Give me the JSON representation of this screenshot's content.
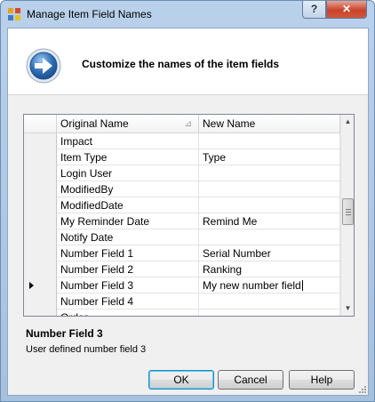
{
  "window": {
    "title": "Manage Item Field Names",
    "help_glyph": "?",
    "close_glyph": "✕"
  },
  "header": {
    "icon": "right-arrow-circle-icon",
    "text": "Customize the names of the item fields"
  },
  "grid": {
    "columns": [
      "Original Name",
      "New Name"
    ],
    "sort_column": "Original Name",
    "rows": [
      {
        "original": "Impact",
        "new": ""
      },
      {
        "original": "Item Type",
        "new": "Type"
      },
      {
        "original": "Login User",
        "new": ""
      },
      {
        "original": "ModifiedBy",
        "new": ""
      },
      {
        "original": "ModifiedDate",
        "new": ""
      },
      {
        "original": "My Reminder Date",
        "new": "Remind Me"
      },
      {
        "original": "Notify Date",
        "new": ""
      },
      {
        "original": "Number Field 1",
        "new": "Serial Number"
      },
      {
        "original": "Number Field 2",
        "new": "Ranking"
      },
      {
        "original": "Number Field 3",
        "new": "My new number field"
      },
      {
        "original": "Number Field 4",
        "new": ""
      },
      {
        "original": "Order",
        "new": ""
      }
    ],
    "current_row_index": 9,
    "scroll_position": 0.45
  },
  "details": {
    "title": "Number Field 3",
    "description": "User defined number field 3"
  },
  "buttons": {
    "ok": "OK",
    "cancel": "Cancel",
    "help": "Help"
  },
  "colors": {
    "titlebar": "#b9d1ea",
    "close_button": "#c8442b",
    "arrow_icon": "#2f6fb8"
  }
}
